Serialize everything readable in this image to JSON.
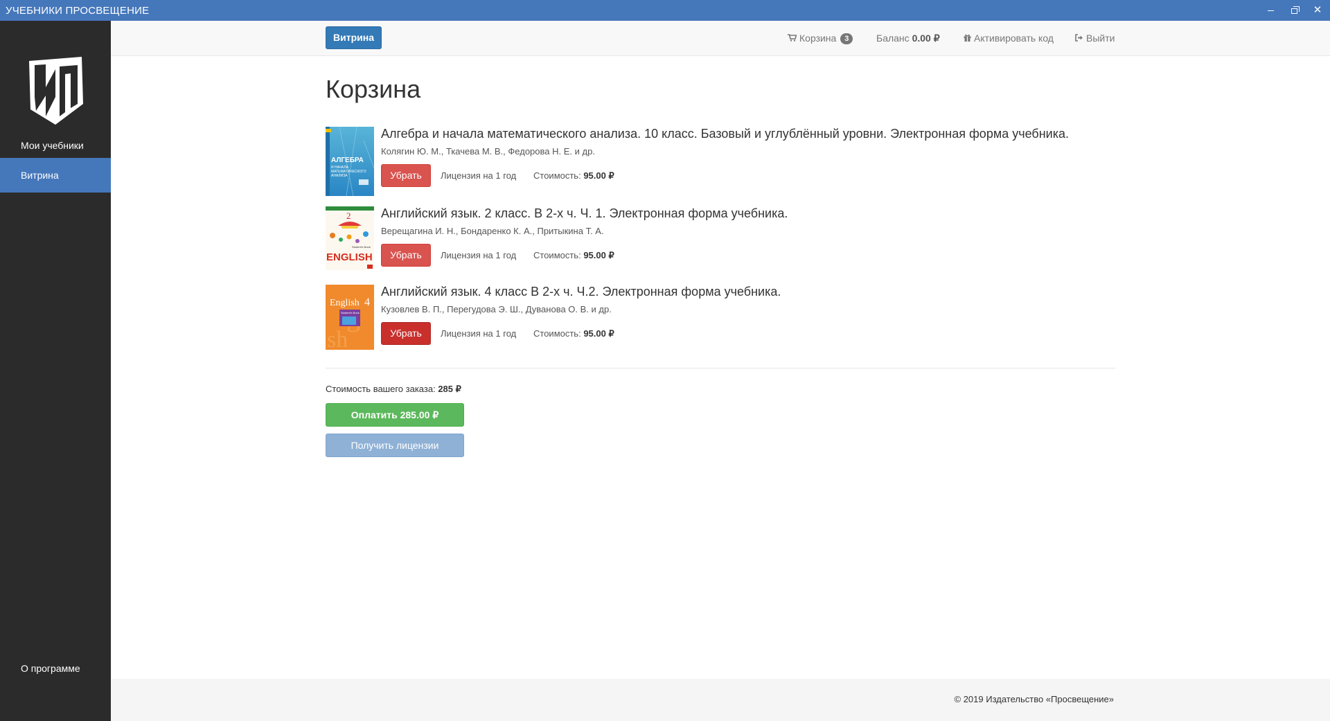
{
  "window": {
    "title": "УЧЕБНИКИ ПРОСВЕЩЕНИЕ",
    "minimize_icon": "minimize-icon",
    "maximize_icon": "restore-icon",
    "close_label": "✕"
  },
  "sidebar": {
    "logo_icon": "prosveshchenie-logo-icon",
    "items": [
      {
        "label": "Мои учебники",
        "active": false
      },
      {
        "label": "Витрина",
        "active": true
      }
    ],
    "about": "О программе"
  },
  "topnav": {
    "vitrina_button": "Витрина",
    "cart_label": "Корзина",
    "cart_count": "3",
    "cart_icon": "cart-icon",
    "balance_label": "Баланс",
    "balance_value": "0.00 ₽",
    "activate_label": "Активировать код",
    "activate_icon": "gift-icon",
    "logout_label": "Выйти",
    "logout_icon": "sign-out-icon"
  },
  "page": {
    "title": "Корзина"
  },
  "cart": {
    "items": [
      {
        "title": "Алгебра и начала математического анализа. 10 класс. Базовый и углублённый уровни. Электронная форма учебника.",
        "authors": "Колягин Ю. М., Ткачева М. В., Федорова Н. Е. и др.",
        "remove_label": "Убрать",
        "license": "Лицензия на 1 год",
        "cost_label": "Стоимость:",
        "cost_value": "95.00 ₽",
        "cover_text": [
          "АЛГЕБРА",
          "И НАЧАЛА",
          "МАТЕМАТИЧЕСКОГО",
          "АНАЛИЗА"
        ]
      },
      {
        "title": "Английский язык. 2 класс. В 2-х ч. Ч. 1. Электронная форма учебника.",
        "authors": "Верещагина И. Н., Бондаренко К. А., Притыкина Т. А.",
        "remove_label": "Убрать",
        "license": "Лицензия на 1 год",
        "cost_label": "Стоимость:",
        "cost_value": "95.00 ₽",
        "cover_text": [
          "2",
          "Student's Book",
          "ENGLISH"
        ]
      },
      {
        "title": "Английский язык. 4 класс В 2-х ч. Ч.2. Электронная форма учебника.",
        "authors": "Кузовлев В. П., Перегудова Э. Ш., Дуванова О. В. и др.",
        "remove_label": "Убрать",
        "license": "Лицензия на 1 год",
        "cost_label": "Стоимость:",
        "cost_value": "95.00 ₽",
        "cover_text": [
          "English",
          "4",
          "Student's Book"
        ]
      }
    ],
    "order_total_label": "Стоимость вашего заказа:",
    "order_total_value": "285 ₽",
    "pay_button": "Оплатить 285.00 ₽",
    "get_licenses_button": "Получить лицензии"
  },
  "footer": {
    "text": "© 2019 Издательство «Просвещение»"
  },
  "colors": {
    "titlebar": "#4577bb",
    "sidebar": "#2b2b2b",
    "primary": "#337ab7",
    "danger": "#d9534f",
    "success": "#5cb85c",
    "disabled_primary": "#8fb1d6"
  }
}
